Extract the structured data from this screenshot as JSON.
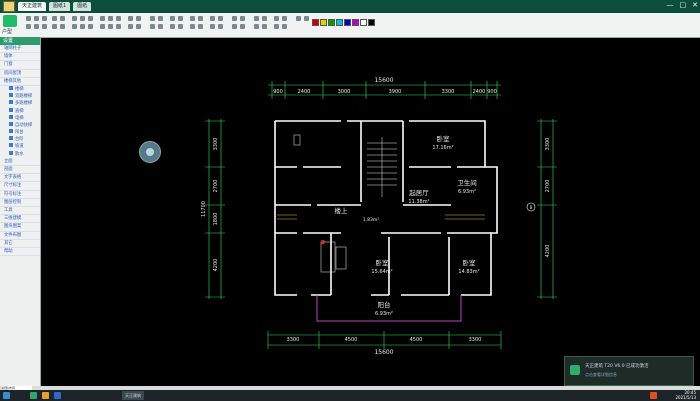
{
  "window": {
    "title": "",
    "tabs": [
      "天正建筑",
      "图纸1",
      "图纸"
    ],
    "controls": [
      "—",
      "□",
      "✕"
    ]
  },
  "ribbon": {
    "logo_label": "户型",
    "swatches": [
      "#d00000",
      "#e0d000",
      "#00a000",
      "#00c8c8",
      "#0000d0",
      "#c000c0",
      "#ffffff",
      "#000000"
    ]
  },
  "sidebar": {
    "header": "设置",
    "items": [
      "轴网柱子",
      "墙体",
      "门窗",
      "房间屋顶",
      "楼梯其他"
    ],
    "subitems": [
      "楼梯",
      "双跑楼梯",
      "多跑楼梯",
      "直梯",
      "电梯",
      "自动扶梯",
      "阳台",
      "台阶",
      "坡道",
      "散水"
    ],
    "items_after": [
      "立面",
      "剖面",
      "文字表格",
      "尺寸标注",
      "符号标注",
      "图层控制",
      "工具",
      "三维建模",
      "图块图案",
      "文件布图",
      "其它",
      "帮助"
    ]
  },
  "drawing": {
    "total_width": "15600",
    "top_dims": [
      "900",
      "2400",
      "3000",
      "3900",
      "3300",
      "2400",
      "900"
    ],
    "bottom_dims": [
      "3300",
      "4500",
      "4500",
      "3300"
    ],
    "left_total": "11700",
    "left_dims": [
      "3300",
      "2700",
      "1800",
      "4200"
    ],
    "right_dims": [
      "3300",
      "2700",
      "4200"
    ],
    "rooms": [
      {
        "name": "卧室",
        "area": "17.16m²"
      },
      {
        "name": "起居厅",
        "area": "11.38m²"
      },
      {
        "name": "卫生间",
        "area": "6.93m²"
      },
      {
        "name": "楼上",
        "area": ""
      },
      {
        "name": "卧室",
        "area": "15.64m²"
      },
      {
        "name": "卧室",
        "area": "14.83m²"
      },
      {
        "name": "阳台",
        "area": "6.93m²"
      }
    ],
    "small_label": "1.83m²",
    "axis_label": "B"
  },
  "status_tab": "模型/布局",
  "taskbar": {
    "window_label": "天正建筑",
    "time": "20:45",
    "date": "2021/5/13"
  },
  "toast": {
    "title": "天正建筑 T20 V6.0 已成功激活",
    "subtitle": "点击查看详细信息"
  }
}
